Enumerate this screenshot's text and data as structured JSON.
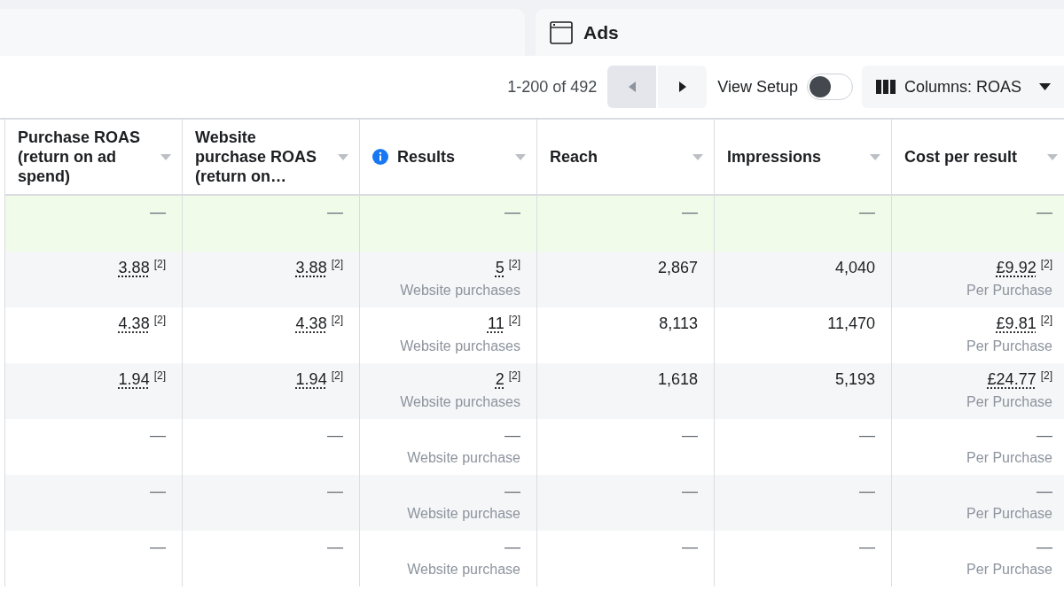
{
  "panel": {
    "title": "Ads"
  },
  "toolbar": {
    "pagination": "1-200 of 492",
    "prev": {
      "disabled": true
    },
    "next": {
      "disabled": false
    },
    "view_setup": {
      "label": "View Setup",
      "on": false
    },
    "columns_button": "Columns: ROAS"
  },
  "table": {
    "columns": [
      {
        "label": "Purchase ROAS (return on ad spend)",
        "info": false
      },
      {
        "label": "Website purchase ROAS (return on…",
        "info": false
      },
      {
        "label": "Results",
        "info": true
      },
      {
        "label": "Reach",
        "info": false
      },
      {
        "label": "Impressions",
        "info": false
      },
      {
        "label": "Cost per result",
        "info": false
      }
    ],
    "rows": [
      {
        "highlighted": true,
        "cells": [
          {
            "value": "—"
          },
          {
            "value": "—"
          },
          {
            "value": "—"
          },
          {
            "value": "—"
          },
          {
            "value": "—"
          },
          {
            "value": "—"
          }
        ]
      },
      {
        "highlighted": false,
        "cells": [
          {
            "value": "3.88",
            "note": "[2]"
          },
          {
            "value": "3.88",
            "note": "[2]"
          },
          {
            "value": "5",
            "note": "[2]",
            "sub": "Website purchases"
          },
          {
            "value": "2,867"
          },
          {
            "value": "4,040"
          },
          {
            "value": "£9.92",
            "note": "[2]",
            "sub": "Per Purchase"
          }
        ]
      },
      {
        "highlighted": false,
        "cells": [
          {
            "value": "4.38",
            "note": "[2]"
          },
          {
            "value": "4.38",
            "note": "[2]"
          },
          {
            "value": "11",
            "note": "[2]",
            "sub": "Website purchases"
          },
          {
            "value": "8,113"
          },
          {
            "value": "11,470"
          },
          {
            "value": "£9.81",
            "note": "[2]",
            "sub": "Per Purchase"
          }
        ]
      },
      {
        "highlighted": false,
        "cells": [
          {
            "value": "1.94",
            "note": "[2]"
          },
          {
            "value": "1.94",
            "note": "[2]"
          },
          {
            "value": "2",
            "note": "[2]",
            "sub": "Website purchases"
          },
          {
            "value": "1,618"
          },
          {
            "value": "5,193"
          },
          {
            "value": "£24.77",
            "note": "[2]",
            "sub": "Per Purchase"
          }
        ]
      },
      {
        "highlighted": false,
        "cells": [
          {
            "value": "—"
          },
          {
            "value": "—"
          },
          {
            "value": "—",
            "sub": "Website purchase"
          },
          {
            "value": "—"
          },
          {
            "value": "—"
          },
          {
            "value": "—",
            "sub": "Per Purchase"
          }
        ]
      },
      {
        "highlighted": false,
        "cells": [
          {
            "value": "—"
          },
          {
            "value": "—"
          },
          {
            "value": "—",
            "sub": "Website purchase"
          },
          {
            "value": "—"
          },
          {
            "value": "—"
          },
          {
            "value": "—",
            "sub": "Per Purchase"
          }
        ]
      },
      {
        "highlighted": false,
        "cells": [
          {
            "value": "—"
          },
          {
            "value": "—"
          },
          {
            "value": "—",
            "sub": "Website purchase"
          },
          {
            "value": "—"
          },
          {
            "value": "—"
          },
          {
            "value": "—",
            "sub": "Per Purchase"
          }
        ]
      }
    ]
  }
}
